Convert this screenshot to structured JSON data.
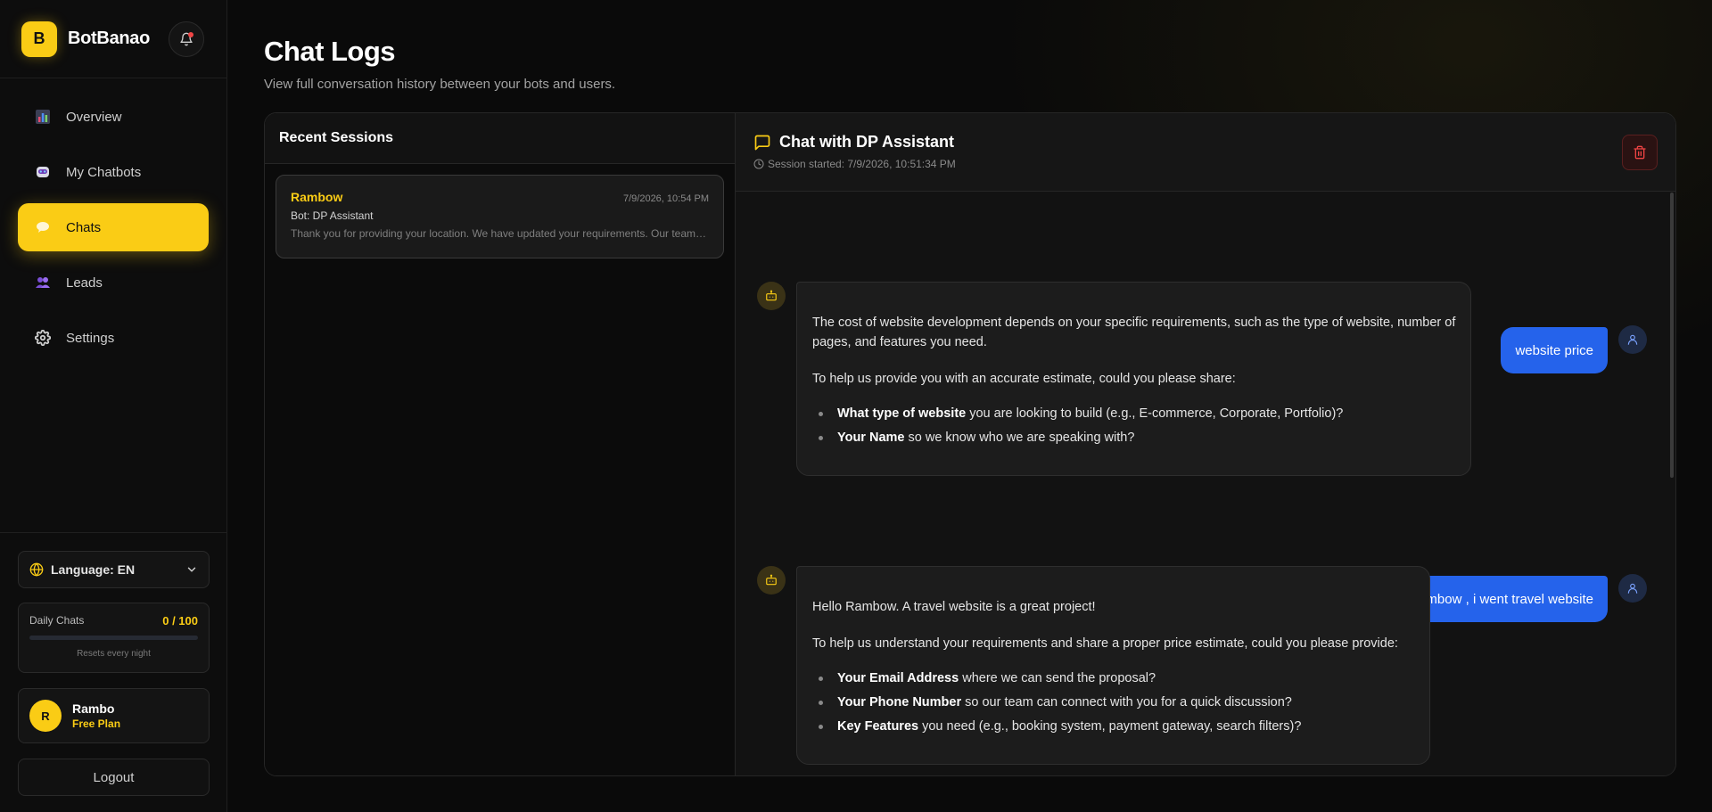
{
  "brand": {
    "logo_letter": "B",
    "name": "BotBanao"
  },
  "nav": [
    {
      "label": "Overview",
      "icon": "bar-chart-icon",
      "active": false
    },
    {
      "label": "My Chatbots",
      "icon": "robot-icon",
      "active": false
    },
    {
      "label": "Chats",
      "icon": "chat-bubble-icon",
      "active": true
    },
    {
      "label": "Leads",
      "icon": "users-icon",
      "active": false
    },
    {
      "label": "Settings",
      "icon": "gear-icon",
      "active": false
    }
  ],
  "language": {
    "label": "Language: EN"
  },
  "usage": {
    "label": "Daily Chats",
    "count": "0 / 100",
    "fraction": 0,
    "note": "Resets every night"
  },
  "user": {
    "initial": "R",
    "name": "Rambo",
    "plan": "Free Plan"
  },
  "logout_label": "Logout",
  "page": {
    "title": "Chat Logs",
    "subtitle": "View full conversation history between your bots and users."
  },
  "sessions": {
    "header": "Recent Sessions",
    "items": [
      {
        "name": "Rambow",
        "time": "7/9/2026, 10:54 PM",
        "bot": "Bot: DP Assistant",
        "preview": "Thank you for providing your location. We have updated your requirements. Our team will contact you shortly."
      }
    ]
  },
  "chat": {
    "title": "Chat with DP Assistant",
    "meta": "Session started: 7/9/2026, 10:51:34 PM",
    "messages": [
      {
        "role": "user",
        "text": "website price"
      },
      {
        "role": "bot",
        "p1": "The cost of website development depends on your specific requirements, such as the type of website, number of pages, and features you need.",
        "p2": "To help us provide you with an accurate estimate, could you please share:",
        "bullets": [
          {
            "bold": "What type of website",
            "rest": " you are looking to build (e.g., E-commerce, Corporate, Portfolio)?"
          },
          {
            "bold": "Your Name",
            "rest": " so we know who we are speaking with?"
          }
        ]
      },
      {
        "role": "user",
        "text": "Rambow , i went travel website"
      },
      {
        "role": "bot",
        "p1": "Hello Rambow. A travel website is a great project!",
        "p2": "To help us understand your requirements and share a proper price estimate, could you please provide:",
        "bullets": [
          {
            "bold": "Your Email Address",
            "rest": " where we can send the proposal?"
          },
          {
            "bold": "Your Phone Number",
            "rest": " so our team can connect with you for a quick discussion?"
          },
          {
            "bold": "Key Features",
            "rest": " you need (e.g., booking system, payment gateway, search filters)?"
          }
        ]
      }
    ]
  },
  "colors": {
    "accent": "#facc15",
    "user_bubble": "#2563eb",
    "danger": "#ef4444"
  }
}
